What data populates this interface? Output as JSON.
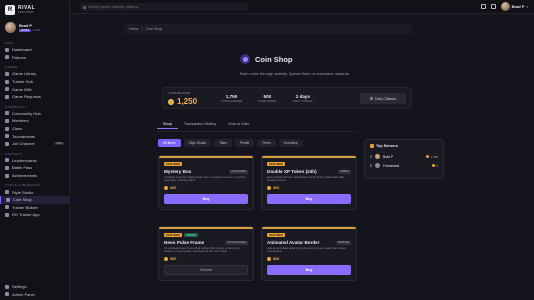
{
  "app": {
    "logo_line1": "RIVAL",
    "logo_line2": "FRONTIER",
    "logo_glyph": "R"
  },
  "profile": {
    "name": "Brad P",
    "badge": "ADMIN",
    "level": "Lvl 14"
  },
  "sidebar": {
    "sections": [
      {
        "title": "MAIN",
        "items": [
          {
            "label": "Dashboard",
            "icon": "grid-icon"
          },
          {
            "label": "Patrons",
            "icon": "heart-icon"
          }
        ]
      },
      {
        "title": "GAMES",
        "items": [
          {
            "label": "Game Library",
            "icon": "library-icon"
          },
          {
            "label": "Trainer Hub",
            "icon": "trainer-icon"
          },
          {
            "label": "Game Wiki",
            "icon": "book-icon"
          },
          {
            "label": "Game Requests",
            "icon": "inbox-icon"
          }
        ]
      },
      {
        "title": "COMMUNITY",
        "items": [
          {
            "label": "Community Hub",
            "icon": "users-icon"
          },
          {
            "label": "Members",
            "icon": "user-icon"
          },
          {
            "label": "Clans",
            "icon": "shield-icon"
          },
          {
            "label": "Tournaments",
            "icon": "trophy-icon"
          },
          {
            "label": "Job Channel",
            "icon": "briefcase-icon",
            "badge": "NEW"
          }
        ]
      },
      {
        "title": "CONTENT",
        "items": [
          {
            "label": "Leaderboards",
            "icon": "chart-icon"
          },
          {
            "label": "Battle Pass",
            "icon": "ticket-icon"
          },
          {
            "label": "Achievements",
            "icon": "medal-icon"
          }
        ]
      },
      {
        "title": "TOOLS & REWARDS",
        "items": [
          {
            "label": "Style Studio",
            "icon": "palette-icon"
          },
          {
            "label": "Coin Shop",
            "icon": "coin-icon",
            "active": true
          },
          {
            "label": "Trainer Builder",
            "icon": "wrench-icon"
          },
          {
            "label": "RG Trainer App",
            "icon": "download-icon"
          }
        ]
      }
    ],
    "bottom": [
      {
        "label": "Settings",
        "icon": "gear-icon"
      },
      {
        "label": "Admin Panel",
        "icon": "lock-icon"
      }
    ]
  },
  "topbar": {
    "search_placeholder": "Search games, trainers, players...",
    "user_name": "Brad P"
  },
  "breadcrumb": {
    "home": "Home",
    "sep": "/",
    "current": "Coin Shop"
  },
  "hero": {
    "title": "Coin Shop",
    "subtitle": "Earn coins through activity. Spend them on exclusive rewards."
  },
  "balance": {
    "label": "YOUR BALANCE",
    "value": "1,250",
    "stats": [
      {
        "value": "1,750",
        "label": "TOTAL EARNED"
      },
      {
        "value": "500",
        "label": "TOTAL SPENT"
      },
      {
        "value": "2 days",
        "label": "DAILY STREAK"
      }
    ],
    "daily_label": "Daily Claimed"
  },
  "tabs": [
    "Shop",
    "Transaction History",
    "How to Earn"
  ],
  "filters": [
    "All Items",
    "Style Studio",
    "Titles",
    "Profile",
    "Perks",
    "Exclusive"
  ],
  "cards": [
    {
      "tags": [
        {
          "t": "FEATURED",
          "c": "feat"
        }
      ],
      "name": "Mystery Box",
      "category": "EXCLUSIVE",
      "desc": "Contains a random Style Studio item. Could be common, could be legendary. Feeling lucky?",
      "price": "200",
      "button": "Buy",
      "owned": false
    },
    {
      "tags": [
        {
          "t": "FEATURED",
          "c": "feat"
        }
      ],
      "name": "Double XP Token (24h)",
      "category": "PERKS",
      "desc": "Earn double XP from all activities for 24 hours. Stack with daily streak bonuses.",
      "price": "400",
      "button": "Buy",
      "owned": false
    },
    {
      "tags": [
        {
          "t": "FEATURED",
          "c": "feat"
        },
        {
          "t": "OWNED",
          "c": "new"
        }
      ],
      "name": "Neon Pulse Frame",
      "category": "STYLE STUDIO",
      "desc": "An animated neon frame that pulses with energy around your avatar on forum posts, comments & the Coin Store.",
      "price": "500",
      "button": "Owned",
      "owned": true
    },
    {
      "tags": [
        {
          "t": "FEATURED",
          "c": "feat"
        }
      ],
      "name": "Animated Avatar Border",
      "category": "PROFILE",
      "desc": "Add an animated glowing border around your avatar that shows everywhere.",
      "price": "800",
      "button": "Buy",
      "owned": false
    }
  ],
  "top_earners": {
    "title": "Top Earners",
    "rows": [
      {
        "rank": "1",
        "name": "Brad P",
        "amount": "1,750",
        "color": "#c9a070"
      },
      {
        "rank": "2",
        "name": "Freshmeat",
        "amount": "0",
        "color": "#8a8aa8"
      }
    ]
  },
  "colors": {
    "accent": "#7b61ff",
    "coin": "#f0b040",
    "bg": "#14141c"
  }
}
